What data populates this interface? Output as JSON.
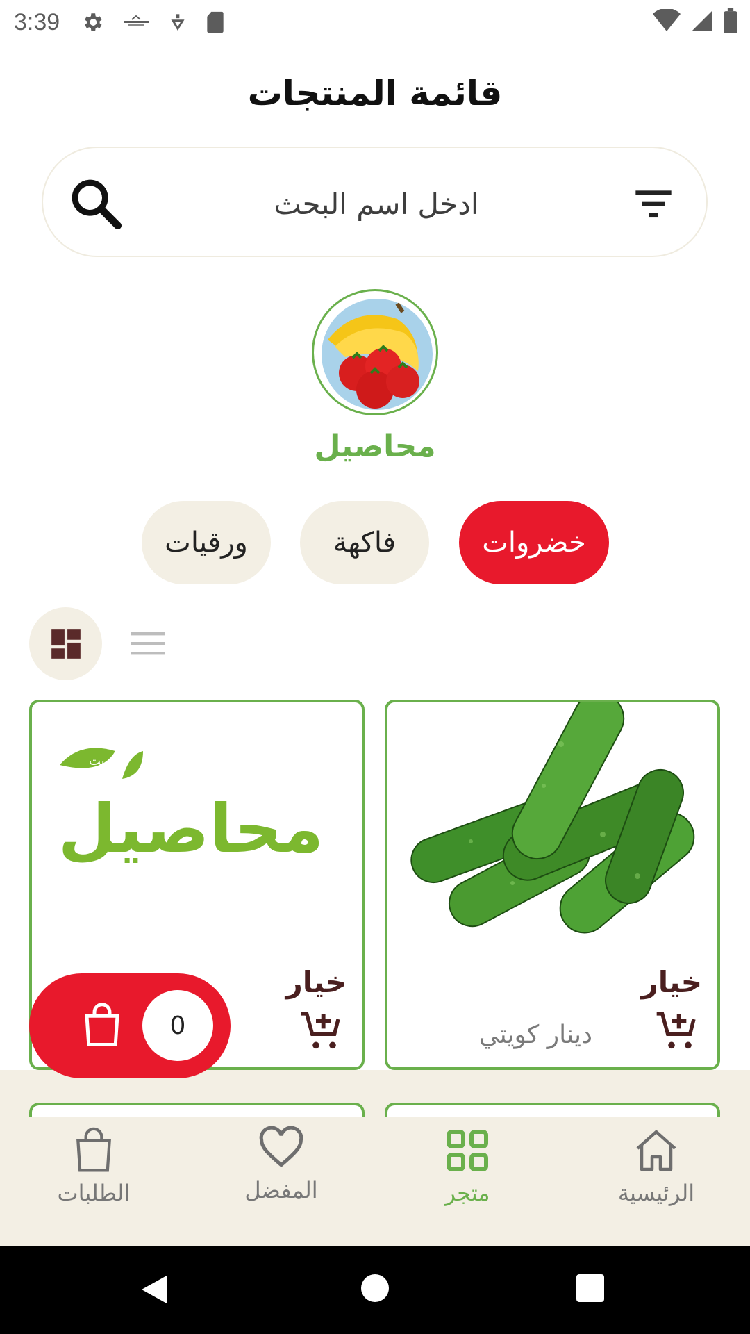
{
  "status_bar": {
    "time": "3:39",
    "icons": [
      "settings-icon",
      "app-logo-icon",
      "location-icon",
      "sd-card-icon",
      "wifi-icon",
      "signal-icon",
      "battery-icon"
    ]
  },
  "header": {
    "title": "قائمة المنتجات"
  },
  "search": {
    "placeholder": "ادخل اسم البحث",
    "value": ""
  },
  "category": {
    "name": "محاصيل",
    "accent_color": "#6ab04c"
  },
  "chips": [
    {
      "label": "خضروات",
      "selected": true
    },
    {
      "label": "فاكهة",
      "selected": false
    },
    {
      "label": "ورقيات",
      "selected": false
    }
  ],
  "view_toggle": {
    "active": "grid"
  },
  "products": [
    {
      "name": "خيار",
      "price_label": "دينار كويتي",
      "image": "cucumbers"
    },
    {
      "name": "خيار",
      "price_label": "",
      "image": "logo-placeholder"
    }
  ],
  "placeholder_logo": {
    "top": "الكويت",
    "main": "محاصيل"
  },
  "cart_fab": {
    "count": "0",
    "color": "#e8192c"
  },
  "bottom_nav": {
    "items": [
      {
        "label": "الرئيسية",
        "icon": "home-icon",
        "active": false
      },
      {
        "label": "متجر",
        "icon": "store-grid-icon",
        "active": true
      },
      {
        "label": "المفضل",
        "icon": "heart-icon",
        "active": false
      },
      {
        "label": "الطلبات",
        "icon": "shopping-bag-icon",
        "active": false
      }
    ]
  }
}
